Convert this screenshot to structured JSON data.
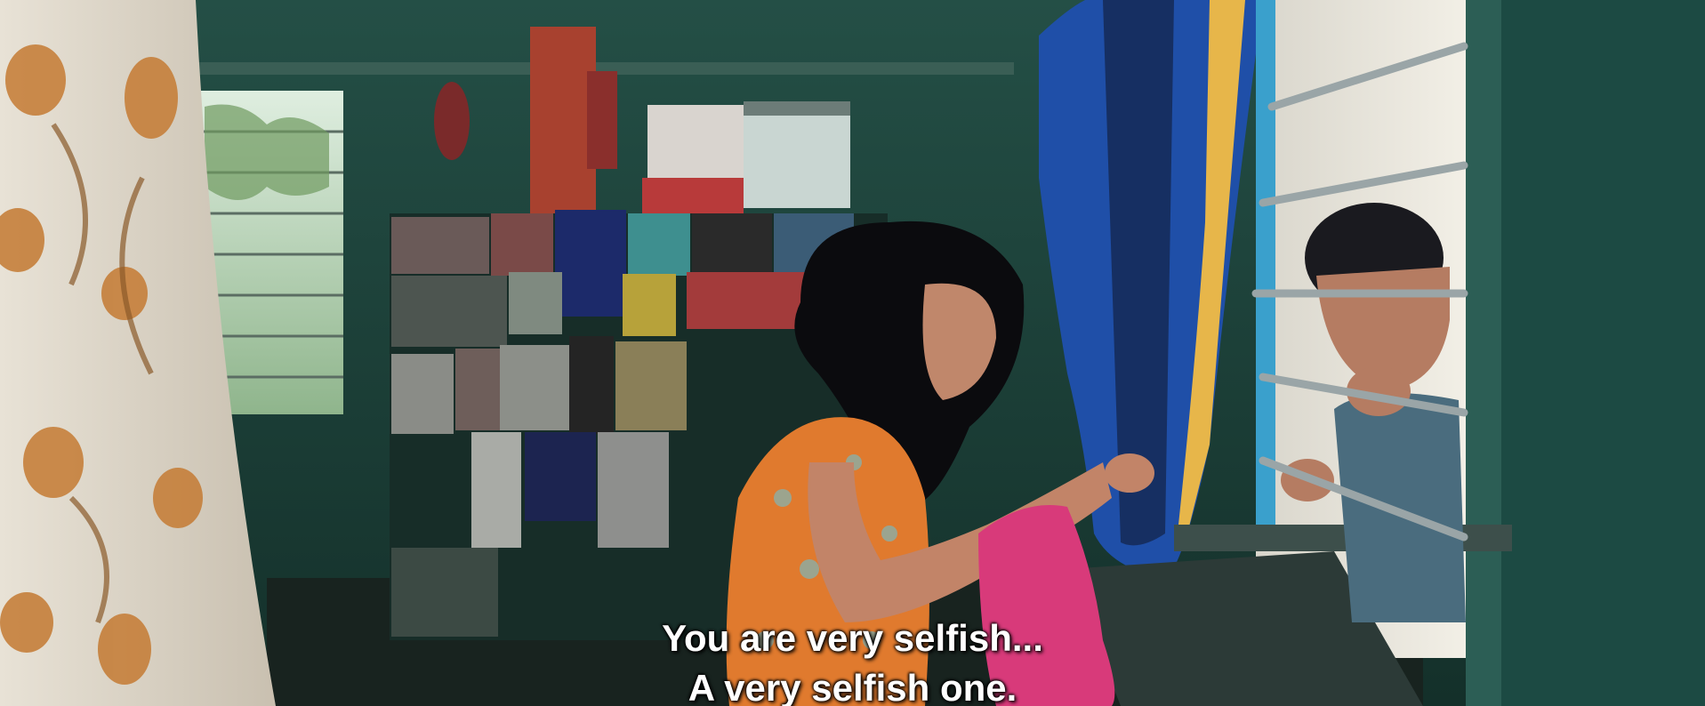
{
  "subtitles": {
    "line1": "You are very selfish...",
    "line2": "A very selfish one."
  },
  "colors": {
    "wall": "#1f4d44",
    "wall_dark": "#142e29",
    "curtain_blue": "#1f4fa8",
    "dress_orange": "#e07a2e",
    "fabric_pink": "#d83a7a",
    "subtitle_text": "#ffffff"
  }
}
